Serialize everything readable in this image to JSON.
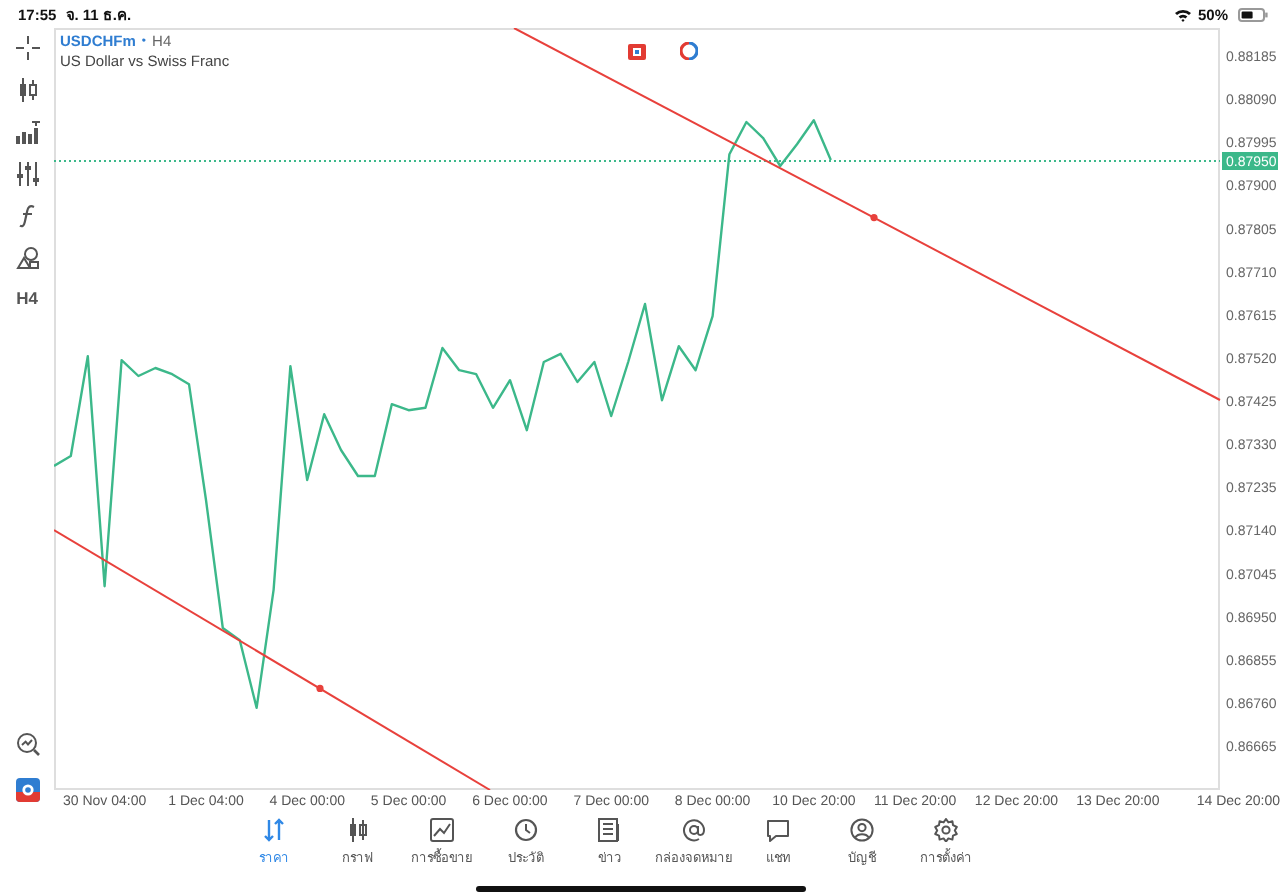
{
  "status_bar": {
    "time": "17:55",
    "date": "จ. 11 ธ.ค.",
    "battery": "50%"
  },
  "toolbar": {
    "timeframe": "H4"
  },
  "symbol": {
    "name": "USDCHFm",
    "separator": "•",
    "timeframe": "H4",
    "description": "US Dollar vs Swiss Franc"
  },
  "chart": {
    "current_price": "0.87950",
    "chart_data": {
      "type": "line",
      "categories": [
        null,
        null,
        null,
        "30 Nov 04:00",
        null,
        null,
        null,
        null,
        null,
        "1 Dec 04:00",
        null,
        null,
        null,
        null,
        null,
        "4 Dec 00:00",
        null,
        null,
        null,
        null,
        null,
        "5 Dec 00:00",
        null,
        null,
        null,
        null,
        null,
        "6 Dec 00:00",
        null,
        null,
        null,
        null,
        null,
        "7 Dec 00:00",
        null,
        null,
        null,
        null,
        null,
        "8 Dec 00:00",
        null,
        null,
        null,
        null,
        null,
        "10 Dec 20:00",
        null,
        null,
        null,
        null,
        null,
        "11 Dec 20:00",
        null,
        null,
        null,
        null,
        null,
        "12 Dec 20:00",
        null,
        null,
        null,
        null,
        null,
        "13 Dec 20:00",
        null,
        null,
        null,
        null,
        null,
        "14 Dec 20:00"
      ],
      "series": [
        {
          "color": "#3cb88a",
          "values": [
            0.87282,
            0.87304,
            0.87524,
            0.87017,
            0.87515,
            0.8748,
            0.87498,
            0.87484,
            0.87462,
            0.87207,
            0.86925,
            0.86898,
            0.86749,
            0.87009,
            0.87502,
            0.87251,
            0.87396,
            0.87317,
            0.8726,
            0.8726,
            0.87418,
            0.87405,
            0.8741,
            0.87542,
            0.87493,
            0.87484,
            0.8741,
            0.87471,
            0.87361,
            0.87511,
            0.87529,
            0.87467,
            0.87511,
            0.87392,
            0.87511,
            0.87639,
            0.87427,
            0.87546,
            0.87493,
            0.87612,
            0.87969,
            0.8804,
            0.88004,
            0.87943,
            0.87991,
            0.88044,
            0.87956,
            null,
            null,
            null,
            null,
            null,
            null,
            null,
            null,
            null,
            null,
            null,
            null,
            null,
            null,
            null,
            null,
            null,
            null,
            null,
            null,
            null,
            null,
            null
          ]
        }
      ],
      "ylim": [
        0.86568,
        0.88247
      ],
      "yticks": [
        {
          "value": 0.88185,
          "label": "0.88185"
        },
        {
          "value": 0.8809,
          "label": "0.88090"
        },
        {
          "value": 0.87995,
          "label": "0.87995"
        },
        {
          "value": 0.879,
          "label": "0.87900"
        },
        {
          "value": 0.87805,
          "label": "0.87805"
        },
        {
          "value": 0.8771,
          "label": "0.87710"
        },
        {
          "value": 0.87615,
          "label": "0.87615"
        },
        {
          "value": 0.8752,
          "label": "0.87520"
        },
        {
          "value": 0.87425,
          "label": "0.87425"
        },
        {
          "value": 0.8733,
          "label": "0.87330"
        },
        {
          "value": 0.87235,
          "label": "0.87235"
        },
        {
          "value": 0.8714,
          "label": "0.87140"
        },
        {
          "value": 0.87045,
          "label": "0.87045"
        },
        {
          "value": 0.8695,
          "label": "0.86950"
        },
        {
          "value": 0.86855,
          "label": "0.86855"
        },
        {
          "value": 0.8676,
          "label": "0.86760"
        },
        {
          "value": 0.86665,
          "label": "0.86665"
        }
      ]
    }
  },
  "tab_bar": [
    {
      "label": "ราคา",
      "selected": true
    },
    {
      "label": "กราฟ",
      "selected": false
    },
    {
      "label": "การซื้อขาย",
      "selected": false
    },
    {
      "label": "ประวัติ",
      "selected": false
    },
    {
      "label": "ข่าว",
      "selected": false
    },
    {
      "label": "กล่องจดหมาย",
      "selected": false
    },
    {
      "label": "แชท",
      "selected": false
    },
    {
      "label": "บัญชี",
      "selected": false
    },
    {
      "label": "การตั้งค่า",
      "selected": false
    }
  ]
}
